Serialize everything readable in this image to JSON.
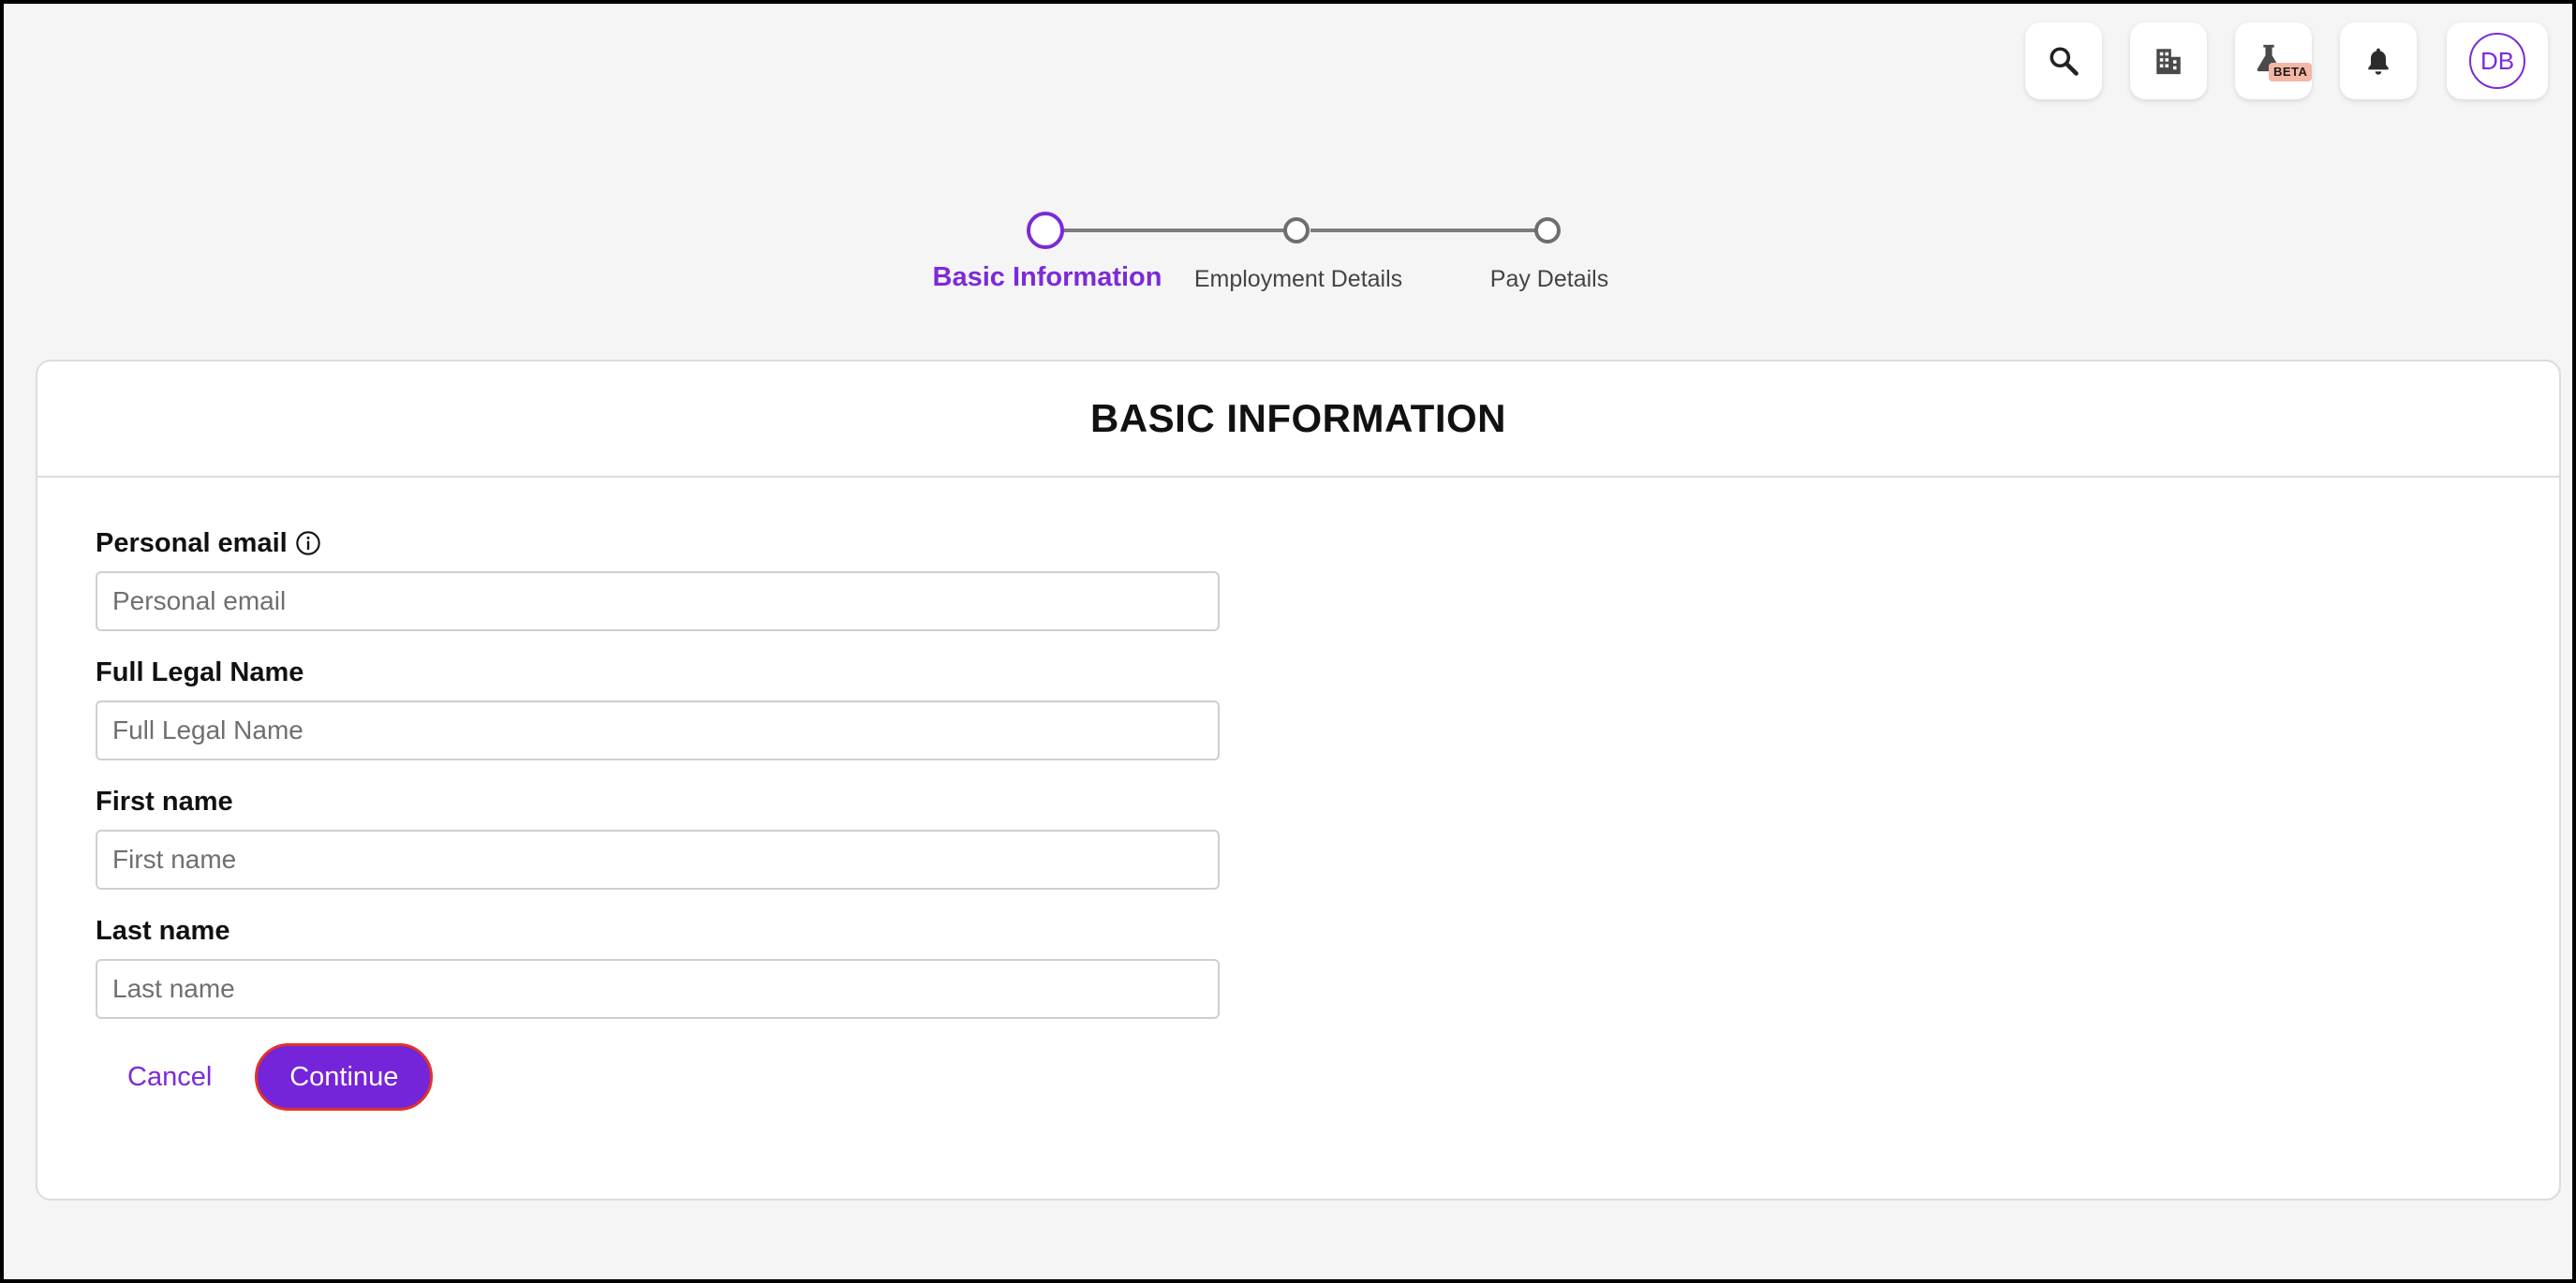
{
  "toolbar": {
    "buttons": [
      {
        "icon": "search-icon"
      },
      {
        "icon": "building-icon"
      },
      {
        "icon": "flask-icon",
        "badge": "BETA"
      },
      {
        "icon": "bell-icon"
      }
    ],
    "avatar_initials": "DB"
  },
  "stepper": {
    "steps": [
      {
        "label": "Basic Information",
        "state": "active"
      },
      {
        "label": "Employment Details",
        "state": "inactive"
      },
      {
        "label": "Pay Details",
        "state": "inactive"
      }
    ]
  },
  "form": {
    "title": "BASIC INFORMATION",
    "fields": [
      {
        "label": "Personal email",
        "placeholder": "Personal email",
        "value": "",
        "has_info_icon": true
      },
      {
        "label": "Full Legal Name",
        "placeholder": "Full Legal Name",
        "value": ""
      },
      {
        "label": "First name",
        "placeholder": "First name",
        "value": ""
      },
      {
        "label": "Last name",
        "placeholder": "Last name",
        "value": ""
      }
    ],
    "cancel_label": "Cancel",
    "continue_label": "Continue"
  },
  "colors": {
    "accent": "#7b2bd6",
    "button_fill": "#7424d9",
    "button_outline": "#e0322b",
    "beta_badge": "#f4b6a6",
    "background": "#f5f5f5"
  }
}
